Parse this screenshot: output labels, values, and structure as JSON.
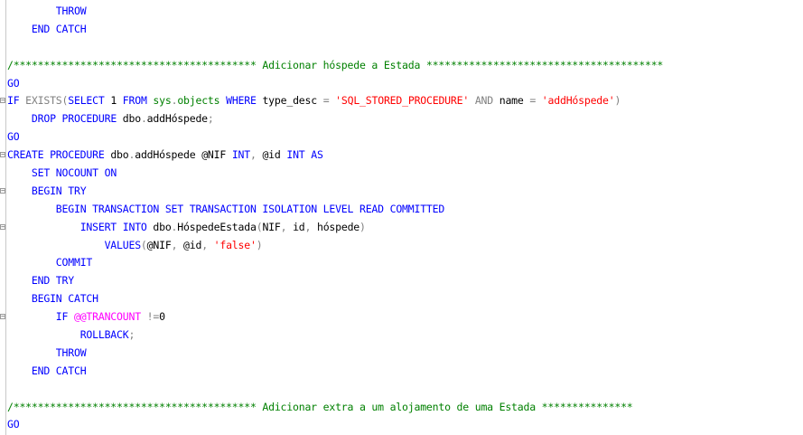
{
  "editor": {
    "lines": [
      [
        {
          "t": "        ",
          "c": "plain"
        },
        {
          "t": "THROW",
          "c": "kw"
        }
      ],
      [
        {
          "t": "    ",
          "c": "plain"
        },
        {
          "t": "END CATCH",
          "c": "kw"
        }
      ],
      [
        {
          "t": "",
          "c": "plain"
        }
      ],
      [
        {
          "t": "/**************************************** Adicionar hóspede a Estada ***************************************",
          "c": "cmt"
        }
      ],
      [
        {
          "t": "GO",
          "c": "kw"
        }
      ],
      [
        {
          "t": "IF ",
          "c": "kw"
        },
        {
          "t": "EXISTS",
          "c": "gray"
        },
        {
          "t": "(",
          "c": "gray"
        },
        {
          "t": "SELECT ",
          "c": "kw"
        },
        {
          "t": "1 ",
          "c": "plain"
        },
        {
          "t": "FROM ",
          "c": "kw"
        },
        {
          "t": "sys",
          "c": "obj"
        },
        {
          "t": ".",
          "c": "gray"
        },
        {
          "t": "objects ",
          "c": "obj"
        },
        {
          "t": "WHERE ",
          "c": "kw"
        },
        {
          "t": "type_desc ",
          "c": "plain"
        },
        {
          "t": "= ",
          "c": "gray"
        },
        {
          "t": "'SQL_STORED_PROCEDURE' ",
          "c": "str"
        },
        {
          "t": "AND ",
          "c": "gray"
        },
        {
          "t": "name ",
          "c": "plain"
        },
        {
          "t": "= ",
          "c": "gray"
        },
        {
          "t": "'addHóspede'",
          "c": "str"
        },
        {
          "t": ")",
          "c": "gray"
        }
      ],
      [
        {
          "t": "    ",
          "c": "plain"
        },
        {
          "t": "DROP PROCEDURE ",
          "c": "kw"
        },
        {
          "t": "dbo",
          "c": "plain"
        },
        {
          "t": ".",
          "c": "gray"
        },
        {
          "t": "addHóspede",
          "c": "plain"
        },
        {
          "t": ";",
          "c": "gray"
        }
      ],
      [
        {
          "t": "GO",
          "c": "kw"
        }
      ],
      [
        {
          "t": "CREATE PROCEDURE ",
          "c": "kw"
        },
        {
          "t": "dbo",
          "c": "plain"
        },
        {
          "t": ".",
          "c": "gray"
        },
        {
          "t": "addHóspede ",
          "c": "plain"
        },
        {
          "t": "@NIF ",
          "c": "plain"
        },
        {
          "t": "INT",
          "c": "kw"
        },
        {
          "t": ", ",
          "c": "gray"
        },
        {
          "t": "@id ",
          "c": "plain"
        },
        {
          "t": "INT ",
          "c": "kw"
        },
        {
          "t": "AS",
          "c": "kw"
        }
      ],
      [
        {
          "t": "    ",
          "c": "plain"
        },
        {
          "t": "SET NOCOUNT ON",
          "c": "kw"
        }
      ],
      [
        {
          "t": "    ",
          "c": "plain"
        },
        {
          "t": "BEGIN TRY",
          "c": "kw"
        }
      ],
      [
        {
          "t": "        ",
          "c": "plain"
        },
        {
          "t": "BEGIN TRANSACTION SET TRANSACTION ISOLATION LEVEL READ COMMITTED",
          "c": "kw"
        }
      ],
      [
        {
          "t": "            ",
          "c": "plain"
        },
        {
          "t": "INSERT INTO ",
          "c": "kw"
        },
        {
          "t": "dbo",
          "c": "plain"
        },
        {
          "t": ".",
          "c": "gray"
        },
        {
          "t": "HóspedeEstada",
          "c": "plain"
        },
        {
          "t": "(",
          "c": "gray"
        },
        {
          "t": "NIF",
          "c": "plain"
        },
        {
          "t": ", ",
          "c": "gray"
        },
        {
          "t": "id",
          "c": "plain"
        },
        {
          "t": ", ",
          "c": "gray"
        },
        {
          "t": "hóspede",
          "c": "plain"
        },
        {
          "t": ")",
          "c": "gray"
        }
      ],
      [
        {
          "t": "                ",
          "c": "plain"
        },
        {
          "t": "VALUES",
          "c": "kw"
        },
        {
          "t": "(",
          "c": "gray"
        },
        {
          "t": "@NIF",
          "c": "plain"
        },
        {
          "t": ", ",
          "c": "gray"
        },
        {
          "t": "@id",
          "c": "plain"
        },
        {
          "t": ", ",
          "c": "gray"
        },
        {
          "t": "'false'",
          "c": "str"
        },
        {
          "t": ")",
          "c": "gray"
        }
      ],
      [
        {
          "t": "        ",
          "c": "plain"
        },
        {
          "t": "COMMIT",
          "c": "kw"
        }
      ],
      [
        {
          "t": "    ",
          "c": "plain"
        },
        {
          "t": "END TRY",
          "c": "kw"
        }
      ],
      [
        {
          "t": "    ",
          "c": "plain"
        },
        {
          "t": "BEGIN CATCH",
          "c": "kw"
        }
      ],
      [
        {
          "t": "        ",
          "c": "plain"
        },
        {
          "t": "IF ",
          "c": "kw"
        },
        {
          "t": "@@TRANCOUNT ",
          "c": "pink"
        },
        {
          "t": "!=",
          "c": "gray"
        },
        {
          "t": "0",
          "c": "plain"
        }
      ],
      [
        {
          "t": "            ",
          "c": "plain"
        },
        {
          "t": "ROLLBACK",
          "c": "kw"
        },
        {
          "t": ";",
          "c": "gray"
        }
      ],
      [
        {
          "t": "        ",
          "c": "plain"
        },
        {
          "t": "THROW",
          "c": "kw"
        }
      ],
      [
        {
          "t": "    ",
          "c": "plain"
        },
        {
          "t": "END CATCH",
          "c": "kw"
        }
      ],
      [
        {
          "t": "",
          "c": "plain"
        }
      ],
      [
        {
          "t": "/**************************************** Adicionar extra a um alojamento de uma Estada ***************",
          "c": "cmt"
        }
      ],
      [
        {
          "t": "GO",
          "c": "kw"
        }
      ]
    ],
    "folds": [
      5,
      8,
      10,
      12,
      17
    ]
  }
}
